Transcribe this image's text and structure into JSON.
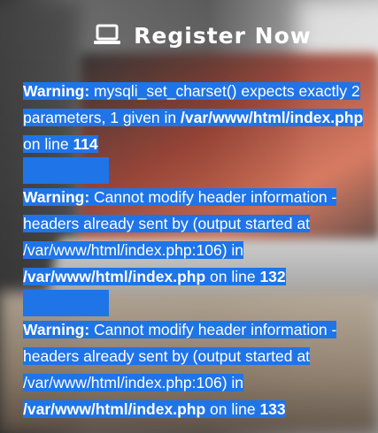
{
  "header": {
    "title": "Register Now",
    "icon": "laptop-icon"
  },
  "warnings": [
    {
      "label": "Warning",
      "lines": [
        [
          "mysqli_set_charset() expects exactly 2"
        ],
        [
          "parameters, 1 given in ",
          "/var/www/html/index.php"
        ],
        [
          "on line ",
          "114"
        ]
      ]
    },
    {
      "label": "Warning",
      "lines": [
        [
          "Cannot modify header information -"
        ],
        [
          "headers already sent by (output started at"
        ],
        [
          "/var/www/html/index.php:106) in"
        ],
        [
          "/var/www/html/index.php",
          " on line ",
          "132"
        ]
      ]
    },
    {
      "label": "Warning",
      "lines": [
        [
          "Cannot modify header information -"
        ],
        [
          "headers already sent by (output started at"
        ],
        [
          "/var/www/html/index.php:106) in"
        ],
        [
          "/var/www/html/index.php",
          " on line ",
          "133"
        ]
      ]
    }
  ],
  "colors": {
    "selection": "#1f74e8",
    "text": "#ffffff"
  }
}
